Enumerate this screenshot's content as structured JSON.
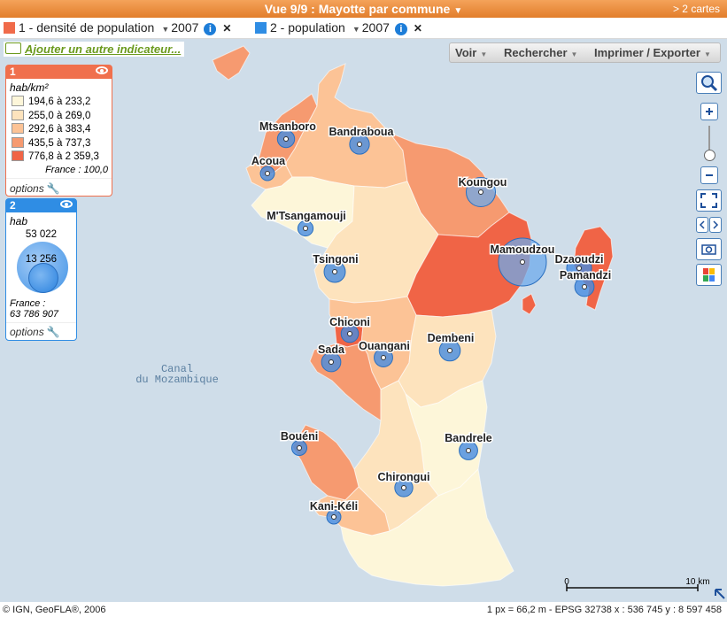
{
  "titlebar": {
    "title": "Vue 9/9 : Mayotte par commune",
    "cartes_link": "> 2 cartes"
  },
  "indicators": [
    {
      "label": "1 - densité de population",
      "year": "2007",
      "color": "#f06b4a"
    },
    {
      "label": "2 - population",
      "year": "2007",
      "color": "#2f8de4"
    }
  ],
  "add_indicator": "Ajouter un autre indicateur...",
  "toolbar": {
    "voir": "Voir",
    "rechercher": "Rechercher",
    "imprimer": "Imprimer / Exporter"
  },
  "legend1": {
    "number": "1",
    "unit": "hab/km²",
    "classes": [
      {
        "label": "194,6 à 233,2",
        "color": "#fdf6d9"
      },
      {
        "label": "255,0 à 269,0",
        "color": "#fde3bd"
      },
      {
        "label": "292,6 à 383,4",
        "color": "#fcc396"
      },
      {
        "label": "435,5 à 737,3",
        "color": "#f69a70"
      },
      {
        "label": "776,8 à 2 359,3",
        "color": "#f06446"
      }
    ],
    "france": "France : 100,0",
    "options": "options"
  },
  "legend2": {
    "number": "2",
    "unit": "hab",
    "max_value": "53 022",
    "min_value": "13 256",
    "france": "France :",
    "france_value": "63 786 907",
    "options": "options"
  },
  "map": {
    "sea_label": "Canal",
    "sea_label2": "du Mozambique",
    "communes": [
      {
        "name": "Mtsanboro",
        "pop": 6850
      },
      {
        "name": "Bandraboua",
        "pop": 9013
      },
      {
        "name": "Acoua",
        "pop": 4605
      },
      {
        "name": "Koungou",
        "pop": 19831
      },
      {
        "name": "M'Tsangamouji",
        "pop": 5383
      },
      {
        "name": "Mamoudzou",
        "pop": 53022
      },
      {
        "name": "Dzaoudzi",
        "pop": 14311
      },
      {
        "name": "Pamandzi",
        "pop": 8590
      },
      {
        "name": "Tsingoni",
        "pop": 10454
      },
      {
        "name": "Chiconi",
        "pop": 6976
      },
      {
        "name": "Sada",
        "pop": 8593
      },
      {
        "name": "Ouangani",
        "pop": 7934
      },
      {
        "name": "Dembeni",
        "pop": 10141
      },
      {
        "name": "Bouéni",
        "pop": 5295
      },
      {
        "name": "Bandrele",
        "pop": 7885
      },
      {
        "name": "Chirongui",
        "pop": 7526
      },
      {
        "name": "Kani-Kéli",
        "pop": 4623
      }
    ],
    "scale_start": "0",
    "scale_end": "10 km"
  },
  "status": {
    "credits": "© IGN, GeoFLA®, 2006",
    "coords": "1 px = 66,2 m - EPSG 32738  x : 536 745   y : 8 597 458"
  }
}
